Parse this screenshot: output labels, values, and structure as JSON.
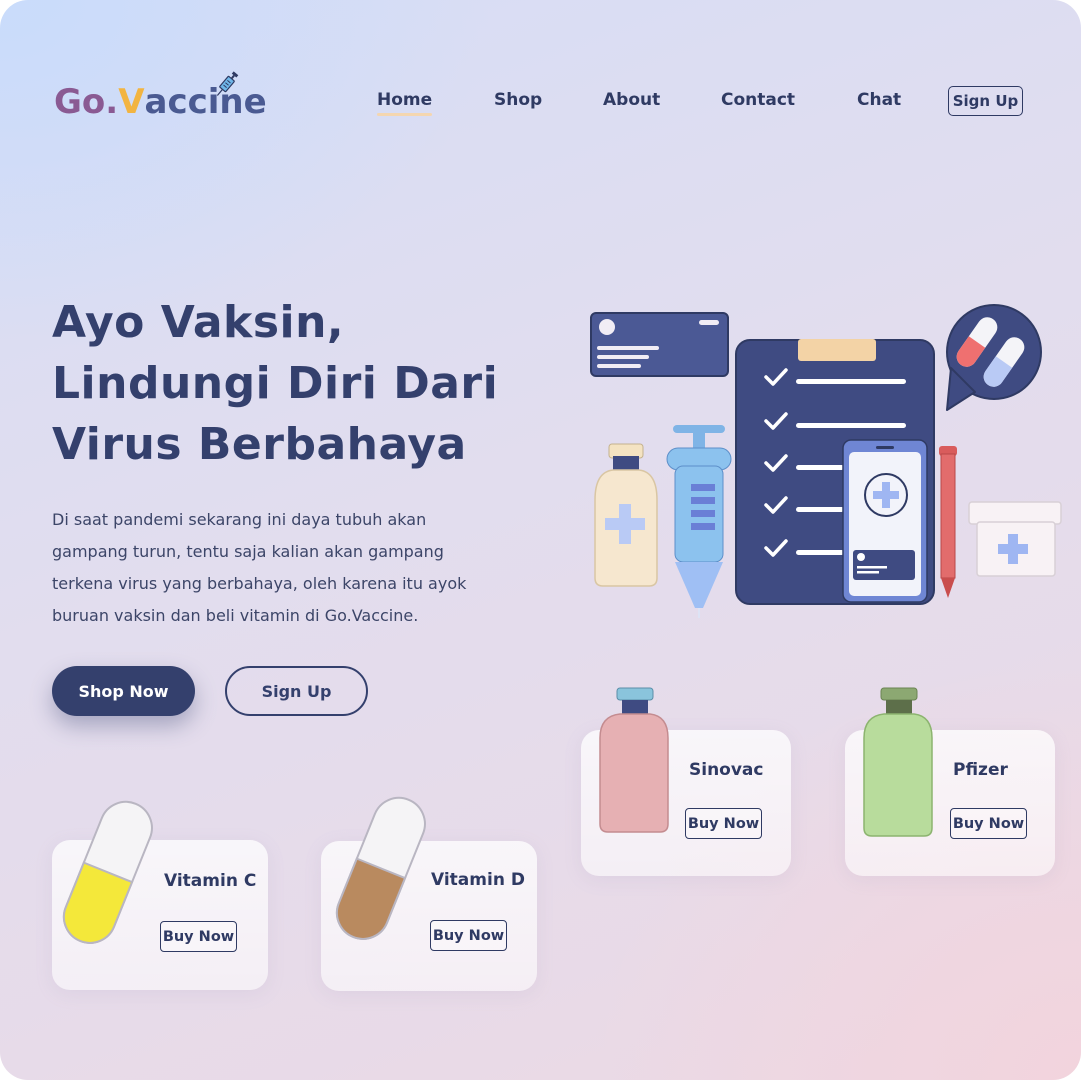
{
  "brand": {
    "logo_text_go": "Go",
    "logo_text_dot": ".",
    "logo_text_v": "V",
    "logo_text_rest": "accine",
    "logo_icon": "syringe-icon"
  },
  "nav": {
    "items": [
      {
        "label": "Home",
        "active": true
      },
      {
        "label": "Shop",
        "active": false
      },
      {
        "label": "About",
        "active": false
      },
      {
        "label": "Contact",
        "active": false
      },
      {
        "label": "Chat",
        "active": false
      }
    ],
    "signup_label": "Sign Up"
  },
  "hero": {
    "title_lines": [
      "Ayo Vaksin,",
      "Lindungi Diri Dari",
      "Virus Berbahaya"
    ],
    "description_lines": [
      "Di saat pandemi sekarang ini daya tubuh akan",
      "gampang turun, tentu saja kalian akan gampang",
      "terkena virus yang berbahaya, oleh karena itu ayok",
      "buruan vaksin dan beli vitamin di Go.Vaccine."
    ],
    "primary_button": "Shop Now",
    "secondary_button": "Sign Up"
  },
  "products": [
    {
      "name": "Vitamin C",
      "button": "Buy Now",
      "icon": "yellow-capsule-icon"
    },
    {
      "name": "Vitamin D",
      "button": "Buy Now",
      "icon": "brown-capsule-icon"
    },
    {
      "name": "Sinovac",
      "button": "Buy Now",
      "icon": "pink-vaccine-bottle-icon"
    },
    {
      "name": "Pfizer",
      "button": "Buy Now",
      "icon": "green-vaccine-bottle-icon"
    }
  ],
  "illustration": {
    "icons": [
      "id-card-icon",
      "clipboard-checklist-icon",
      "pill-chat-bubble-icon",
      "medicine-bottle-icon",
      "syringe-icon",
      "phone-medical-icon",
      "pen-icon",
      "first-aid-box-icon"
    ]
  },
  "colors": {
    "primary": "#34406d",
    "accent_yellow": "#f2b441",
    "logo_purple": "#8a5a93",
    "nav_underline": "#f4d6b0"
  }
}
